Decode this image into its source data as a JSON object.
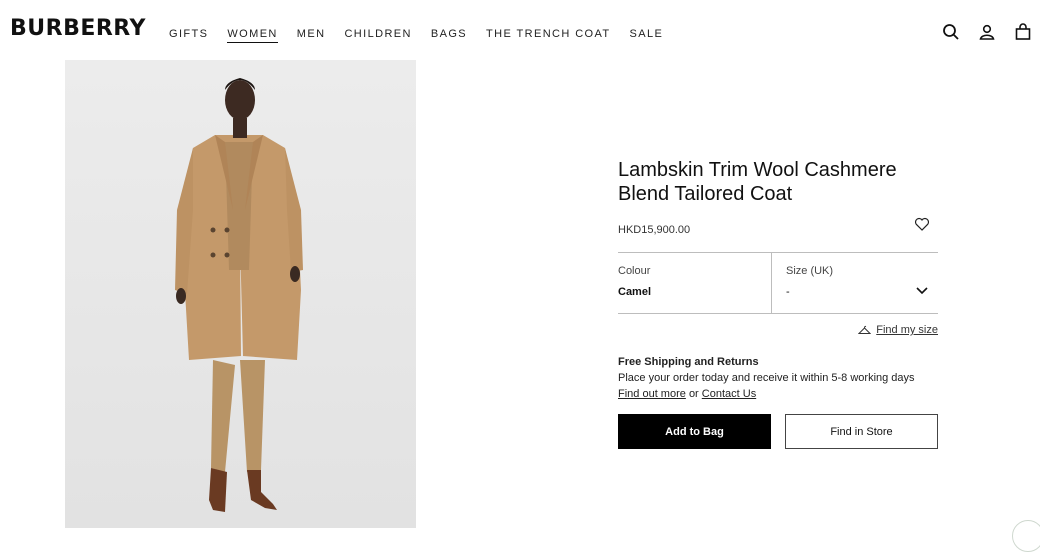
{
  "brand": "BURBERRY",
  "nav": [
    {
      "label": "GIFTS",
      "active": false
    },
    {
      "label": "WOMEN",
      "active": true
    },
    {
      "label": "MEN",
      "active": false
    },
    {
      "label": "CHILDREN",
      "active": false
    },
    {
      "label": "BAGS",
      "active": false
    },
    {
      "label": "THE TRENCH COAT",
      "active": false
    },
    {
      "label": "SALE",
      "active": false
    }
  ],
  "header_icons": [
    "search-icon",
    "account-icon",
    "bag-icon"
  ],
  "product": {
    "title": "Lambskin Trim Wool Cashmere Blend Tailored Coat",
    "price": "HKD15,900.00",
    "colour_label": "Colour",
    "colour_value": "Camel",
    "size_label": "Size (UK)",
    "size_value": "-",
    "find_size": "Find my size"
  },
  "shipping": {
    "title": "Free Shipping and Returns",
    "text": "Place your order today and receive it within 5-8 working days",
    "link_more": "Find out more",
    "or": "or",
    "link_contact": "Contact Us"
  },
  "buttons": {
    "add_to_bag": "Add to Bag",
    "find_in_store": "Find in Store"
  },
  "colors": {
    "coat": "#c4996a",
    "suit": "#b89466",
    "boot": "#6a3a22",
    "photo_bg": "#e6e6e6"
  }
}
